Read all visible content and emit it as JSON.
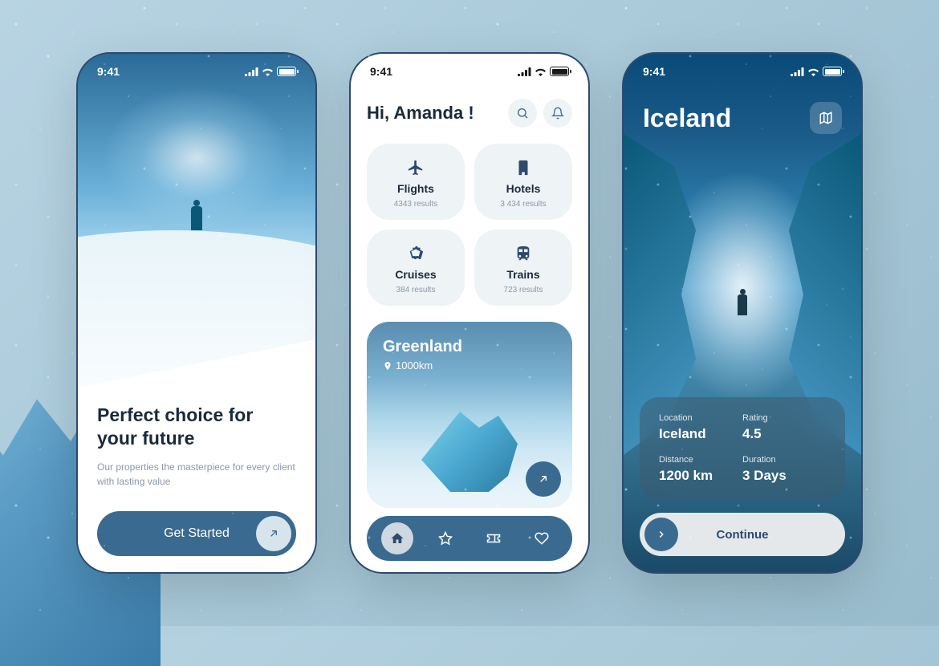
{
  "status": {
    "time": "9:41"
  },
  "onboarding": {
    "title": "Perfect choice for your future",
    "subtitle": "Our properties the masterpiece for every client with lasting value",
    "cta": "Get Started"
  },
  "home": {
    "greeting": "Hi, Amanda !",
    "categories": [
      {
        "label": "Flights",
        "results": "4343 results"
      },
      {
        "label": "Hotels",
        "results": "3 434 results"
      },
      {
        "label": "Cruises",
        "results": "384 results"
      },
      {
        "label": "Trains",
        "results": "723 results"
      }
    ],
    "featured": {
      "name": "Greenland",
      "distance": "1000km"
    }
  },
  "detail": {
    "title": "Iceland",
    "info": {
      "location_label": "Location",
      "location": "Iceland",
      "rating_label": "Rating",
      "rating": "4.5",
      "distance_label": "Distance",
      "distance": "1200 km",
      "duration_label": "Duration",
      "duration": "3 Days"
    },
    "cta": "Continue"
  }
}
